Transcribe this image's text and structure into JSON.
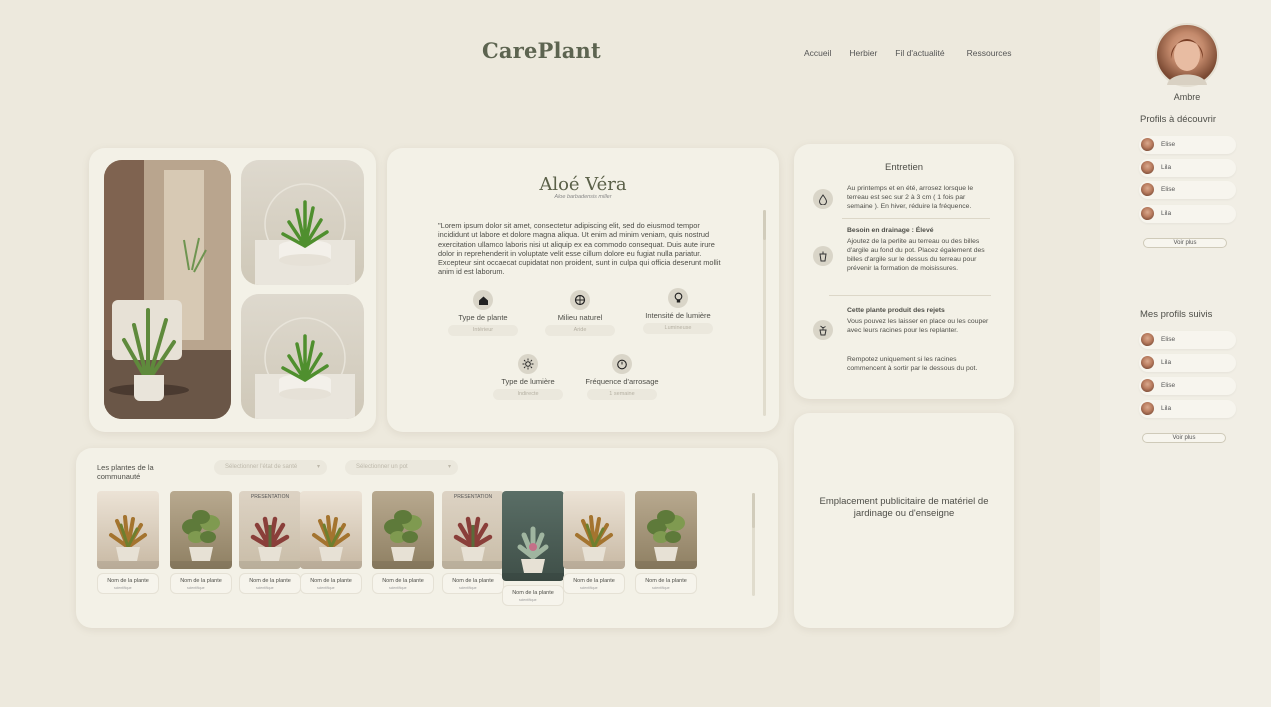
{
  "header": {
    "logo": "CarePlant",
    "nav": [
      "Accueil",
      "Herbier",
      "Fil d'actualité",
      "Ressources"
    ]
  },
  "plant": {
    "name": "Aloé Véra",
    "scientific": "Aloe barbadensis miller",
    "description": "\"Lorem ipsum dolor sit amet, consectetur adipiscing elit, sed do eiusmod tempor incididunt ut labore et dolore magna aliqua. Ut enim ad minim veniam, quis nostrud exercitation ullamco laboris nisi ut aliquip ex ea commodo consequat. Duis aute irure dolor in reprehenderit in voluptate velit esse cillum dolore eu fugiat nulla pariatur. Excepteur sint occaecat cupidatat non proident, sunt in culpa qui officia deserunt mollit anim id est laborum.",
    "attributes": [
      {
        "label": "Type de plante",
        "value": "Intérieur",
        "icon": "home-icon"
      },
      {
        "label": "Milieu naturel",
        "value": "Aride",
        "icon": "globe-icon"
      },
      {
        "label": "Intensité de lumière",
        "value": "Lumineuse",
        "icon": "bulb-icon"
      },
      {
        "label": "Type de lumière",
        "value": "Indirecte",
        "icon": "sun-icon"
      },
      {
        "label": "Fréquence d'arrosage",
        "value": "1 semaine",
        "icon": "timer-icon"
      }
    ]
  },
  "care": {
    "title": "Entretien",
    "items": [
      {
        "icon": "water-drop-icon",
        "heading": "",
        "text": "Au printemps et en été, arrosez lorsque le terreau est sec sur 2 à 3 cm ( 1 fois par semaine ). En hiver, réduire la fréquence."
      },
      {
        "icon": "pot-drainage-icon",
        "heading": "Besoin en drainage : Élevé",
        "text": "Ajoutez de la perlite au terreau ou des billes d'argile au fond du pot. Placez également des billes d'argile sur le dessus du terreau pour prévenir la formation de moisissures."
      },
      {
        "icon": "sprout-pot-icon",
        "heading": "Cette plante produit des rejets",
        "text": "Vous pouvez les laisser en place ou les couper avec leurs racines pour les replanter."
      },
      {
        "icon": "",
        "heading": "",
        "text": "Rempotez uniquement si les racines commencent à sortir par le dessous du pot."
      }
    ]
  },
  "ad": {
    "text": "Emplacement publicitaire de matériel de jardinage ou d'enseigne"
  },
  "community": {
    "title": "Les plantes de la communauté",
    "select_health": "Sélectionner l'état de santé",
    "select_pot": "Sélectionner un pot",
    "plants": [
      {
        "name": "Nom de la plante",
        "sub": "scientifique",
        "style": "fern"
      },
      {
        "name": "Nom de la plante",
        "sub": "scientifique",
        "style": "round"
      },
      {
        "name": "Nom de la plante",
        "sub": "scientifique",
        "style": "red",
        "tag": "PRESENTATION"
      },
      {
        "name": "Nom de la plante",
        "sub": "scientifique",
        "style": "fern"
      },
      {
        "name": "Nom de la plante",
        "sub": "scientifique",
        "style": "round"
      },
      {
        "name": "Nom de la plante",
        "sub": "scientifique",
        "style": "red",
        "tag": "PRESENTATION"
      },
      {
        "name": "Nom de la plante",
        "sub": "scientifique",
        "style": "succulent"
      },
      {
        "name": "Nom de la plante",
        "sub": "scientifique",
        "style": "fern"
      },
      {
        "name": "Nom de la plante",
        "sub": "scientifique",
        "style": "round"
      }
    ]
  },
  "sidebar": {
    "user": "Ambre",
    "discover_title": "Profils à découvrir",
    "discover": [
      "Elise",
      "Lila",
      "Elise",
      "Lila"
    ],
    "followed_title": "Mes profils suivis",
    "followed": [
      "Elise",
      "Lila",
      "Elise",
      "Lila"
    ],
    "more_label": "Voir plus"
  }
}
